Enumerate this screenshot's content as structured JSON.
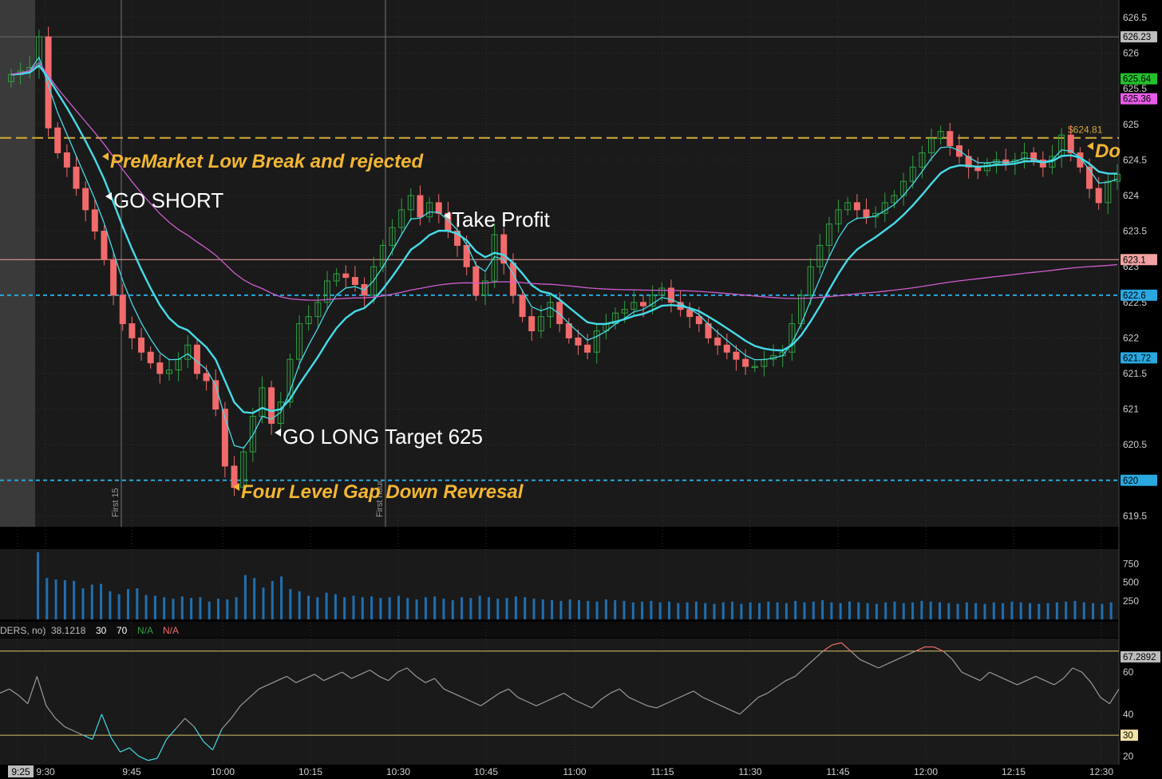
{
  "chart_data": [
    {
      "type": "candlestick",
      "ylim": [
        619.4,
        626.6
      ],
      "y_ticks": [
        "626.5",
        "626",
        "625.5",
        "625",
        "624.5",
        "624",
        "623.5",
        "623",
        "622.5",
        "622",
        "621.5",
        "621",
        "620.5",
        "620",
        "619.5"
      ],
      "x_ticks": [
        "9:25",
        "9:30",
        "9:45",
        "10:00",
        "10:15",
        "10:30",
        "10:45",
        "11:00",
        "11:15",
        "11:30",
        "11:45",
        "12:00",
        "12:15",
        "12:30"
      ],
      "price_tags": [
        {
          "value": 626.23,
          "text": "626.23",
          "bg": "#bdbdbd",
          "fg": "#000000"
        },
        {
          "value": 625.64,
          "text": "625.64",
          "bg": "#22c22c",
          "fg": "#000000"
        },
        {
          "value": 625.36,
          "text": "625.36",
          "bg": "#e85ce8",
          "fg": "#000000"
        },
        {
          "value": 623.1,
          "text": "623.1",
          "bg": "#f1a3a3",
          "fg": "#000000"
        },
        {
          "value": 622.6,
          "text": "622.6",
          "bg": "#29a8e0",
          "fg": "#000000"
        },
        {
          "value": 621.72,
          "text": "621.72",
          "bg": "#29a8e0",
          "fg": "#000000"
        },
        {
          "value": 620,
          "text": "620",
          "bg": "#29a8e0",
          "fg": "#000000"
        }
      ],
      "levels": [
        {
          "value": 624.81,
          "style": "dashed",
          "color": "#d4a83a",
          "label": "$624.81"
        },
        {
          "value": 622.6,
          "style": "dashed",
          "color": "#29a8e0"
        },
        {
          "value": 620.0,
          "style": "dashed",
          "color": "#29a8e0"
        },
        {
          "value": 623.1,
          "style": "solid",
          "color": "#f1a3a3"
        },
        {
          "value": 626.23,
          "style": "solid",
          "color": "#6b6b6b"
        }
      ],
      "vertical_markers": [
        "First 15",
        "First hour"
      ],
      "annotations": [
        {
          "text": "PreMarket Low Break and rejected",
          "color": "#f2b632"
        },
        {
          "text": "GO SHORT",
          "color": "#ffffff"
        },
        {
          "text": "Take Profit",
          "color": "#ffffff"
        },
        {
          "text": "GO LONG Target 625",
          "color": "#ffffff"
        },
        {
          "text": "Four Level Gap Down Revresal",
          "color": "#f2b632"
        },
        {
          "text": "Do",
          "color": "#f2b632"
        }
      ],
      "close_series": [
        625.7,
        625.75,
        625.8,
        626.23,
        624.95,
        624.6,
        624.4,
        624.1,
        623.8,
        623.5,
        623.1,
        622.6,
        622.2,
        622.0,
        621.8,
        621.65,
        621.5,
        621.55,
        621.7,
        621.9,
        621.5,
        621.4,
        621.0,
        620.2,
        619.9,
        620.4,
        620.9,
        621.3,
        620.8,
        621.1,
        621.7,
        622.2,
        622.3,
        622.5,
        622.8,
        622.9,
        622.85,
        622.75,
        622.6,
        623.0,
        623.3,
        623.55,
        623.8,
        624.0,
        623.7,
        623.9,
        623.75,
        623.5,
        623.3,
        623.0,
        622.6,
        622.8,
        623.45,
        623.05,
        622.6,
        622.3,
        622.1,
        622.3,
        622.5,
        622.2,
        622.0,
        621.9,
        621.8,
        622.1,
        622.2,
        622.35,
        622.4,
        622.5,
        622.45,
        622.6,
        622.7,
        622.5,
        622.4,
        622.3,
        622.2,
        622.0,
        621.9,
        621.8,
        621.7,
        621.6,
        621.6,
        621.7,
        621.75,
        621.8,
        622.2,
        622.6,
        623.0,
        623.3,
        623.6,
        623.8,
        623.9,
        623.8,
        623.7,
        623.75,
        623.9,
        624.0,
        624.2,
        624.4,
        624.6,
        624.8,
        624.9,
        624.7,
        624.55,
        624.4,
        624.35,
        624.45,
        624.5,
        624.45,
        624.5,
        624.6,
        624.5,
        624.4,
        624.55,
        624.85,
        624.6,
        624.4,
        624.1,
        623.9,
        624.2,
        624.3
      ],
      "series": [
        {
          "name": "",
          "color": "#46dbe8"
        },
        {
          "name": "",
          "color": "#46dbe8"
        },
        {
          "name": "",
          "color": "#d15cd1"
        }
      ]
    },
    {
      "type": "bar",
      "name": "volume",
      "y_ticks": [
        "750",
        "500",
        "250"
      ],
      "ylim": [
        0,
        950
      ],
      "values": [
        910,
        560,
        540,
        530,
        520,
        420,
        470,
        480,
        380,
        340,
        410,
        420,
        330,
        320,
        300,
        280,
        310,
        290,
        300,
        240,
        280,
        270,
        300,
        600,
        560,
        430,
        520,
        580,
        410,
        380,
        320,
        300,
        360,
        340,
        300,
        320,
        300,
        310,
        290,
        300,
        320,
        290,
        270,
        300,
        310,
        280,
        260,
        300,
        290,
        320,
        300,
        280,
        290,
        310,
        300,
        280,
        270,
        260,
        250,
        270,
        260,
        250,
        240,
        270,
        260,
        250,
        230,
        240,
        250,
        230,
        240,
        220,
        230,
        240,
        220,
        210,
        230,
        240,
        210,
        230,
        220,
        240,
        230,
        220,
        250,
        230,
        240,
        260,
        230,
        220,
        240,
        230,
        220,
        210,
        230,
        240,
        220,
        230,
        250,
        240,
        230,
        220,
        210,
        230,
        220,
        210,
        230,
        220,
        240,
        230,
        220,
        210,
        220,
        230,
        240,
        250,
        230,
        220,
        210,
        230
      ]
    },
    {
      "type": "line",
      "name": "rsi",
      "header": [
        "DERS, no)",
        "38.1218",
        "30",
        "70",
        "N/A",
        "N/A"
      ],
      "y_ticks": [
        "60",
        "40",
        "20"
      ],
      "ylim": [
        16,
        76
      ],
      "levels": [
        {
          "value": 70,
          "color": "#d9c26a"
        },
        {
          "value": 30,
          "color": "#d9c26a"
        }
      ],
      "tags": [
        {
          "value": 67.2892,
          "text": "67.2892",
          "bg": "#bdbdbd"
        },
        {
          "value": 30,
          "text": "30",
          "bg": "#f4e2a6"
        }
      ],
      "values": [
        50,
        52,
        49,
        45,
        58,
        44,
        38,
        34,
        32,
        30,
        28,
        40,
        29,
        22,
        24,
        20,
        18,
        19,
        28,
        33,
        38,
        34,
        27,
        23,
        33,
        38,
        44,
        48,
        52,
        54,
        56,
        58,
        55,
        57,
        59,
        56,
        58,
        60,
        57,
        59,
        61,
        58,
        56,
        60,
        62,
        58,
        55,
        57,
        52,
        50,
        48,
        46,
        44,
        47,
        50,
        52,
        48,
        46,
        44,
        46,
        48,
        50,
        47,
        45,
        43,
        47,
        50,
        52,
        48,
        46,
        44,
        43,
        45,
        47,
        49,
        51,
        48,
        46,
        44,
        42,
        40,
        44,
        48,
        50,
        53,
        56,
        58,
        62,
        66,
        70,
        73,
        74,
        70,
        66,
        64,
        62,
        64,
        66,
        68,
        70,
        72,
        72,
        70,
        66,
        60,
        58,
        56,
        60,
        58,
        56,
        54,
        56,
        58,
        56,
        54,
        57,
        62,
        60,
        55,
        48,
        45,
        52
      ]
    }
  ]
}
